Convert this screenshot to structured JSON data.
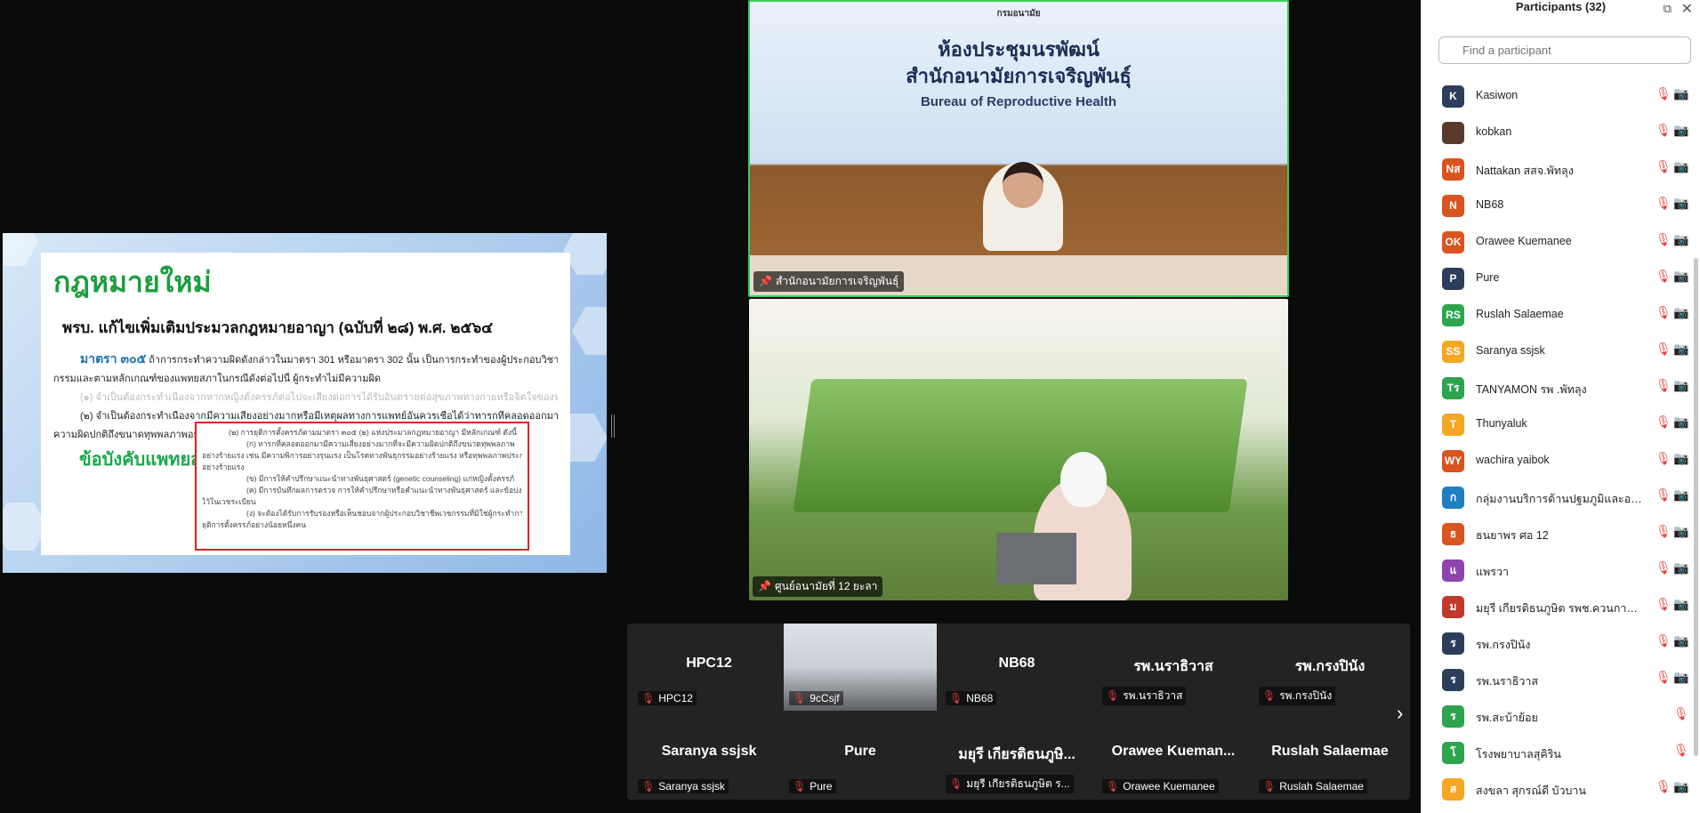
{
  "shared_slide": {
    "title": "กฎหมายใหม่",
    "subtitle": "พรบ. แก้ไขเพิ่มเติมประมวลกฎหมายอาญา (ฉบับที่ ๒๘) พ.ศ. ๒๕๖๔",
    "section_label": "มาตรา ๓๐๕",
    "line1": "ถ้าการกระทำความผิดดังกล่าวในมาตรา 301 หรือมาตรา 302 นั้น เป็นการกระทำของผู้ประกอบวิชาชีพเวช",
    "line2": "กรรมและตามหลักเกณฑ์ของแพทยสภาในกรณีดังต่อไปนี้ ผู้กระทำไม่มีความผิด",
    "line3": "(๑) จำเป็นต้องกระทำเนื่องจากหากหญิงตั้งครรภ์ต่อไปจะเสี่ยงต่อการได้รับอันตรายต่อสุขภาพทางกายหรือจิตใจของหญิงนั้น",
    "line4": "(๒) จำเป็นต้องกระทำเนื่องจากมีความเสี่ยงอย่างมากหรือมีเหตุผลทางการแพทย์อันควรเชื่อได้ว่าทารกที่คลอดออกมาจะมี",
    "line5": "ความผิดปกติถึงขนาดทุพพลภาพอย่างร้ายแรง",
    "watermark": "ข้อบังคับแพทยสภา",
    "box_lines": [
      "(๒) การยุติการตั้งครรภ์ตามมาตรา ๓๐๕ (๒) แห่งประมวลกฎหมายอาญา มีหลักเกณฑ์ ดังนี้",
      "(ก) ทารกที่คลอดออกมามีความเสี่ยงอย่างมากที่จะมีความผิดปกติถึงขนาดทุพพลภาพ",
      "อย่างร้ายแรง เช่น มีความพิการอย่างรุนแรง เป็นโรคทางพันธุกรรมอย่างร้ายแรง หรือทุพพลภาพประการอื่น",
      "อย่างร้ายแรง",
      "(ข) มีการให้คำปรึกษาแนะนำทางพันธุศาสตร์ (genetic counseling) แก่หญิงตั้งครรภ์",
      "(ค) มีการบันทึกผลการตรวจ การให้คำปรึกษาหรือคำแนะนำทางพันธุศาสตร์ และข้อบ่งชี้",
      "ไว้ในเวชระเบียน",
      "(ง) จะต้องได้รับการรับรองหรือเห็นชอบจากผู้ประกอบวิชาชีพเวชกรรมที่มิใช่ผู้กระทำการ",
      "ยุติการตั้งครรภ์อย่างน้อยหนึ่งคน"
    ]
  },
  "video_top": {
    "logo_text": "กรมอนามัย",
    "room_line1": "ห้องประชุมนรพัฒน์",
    "room_line2": "สำนักอนามัยการเจริญพันธุ์",
    "room_en": "Bureau of Reproductive Health",
    "name": "สำนักอนามัยการเจริญพันธุ์"
  },
  "video_bottom": {
    "name": "ศูนย์อนามัยที่ 12 ยะลา"
  },
  "gallery": {
    "tiles": [
      {
        "name": "HPC12",
        "label": "HPC12"
      },
      {
        "name": "",
        "label": "9cCsjf"
      },
      {
        "name": "NB68",
        "label": "NB68"
      },
      {
        "name": "รพ.นราธิวาส",
        "label": "รพ.นราธิวาส"
      },
      {
        "name": "รพ.กรงปินัง",
        "label": "รพ.กรงปินัง"
      },
      {
        "name": "Saranya ssjsk",
        "label": "Saranya ssjsk"
      },
      {
        "name": "Pure",
        "label": "Pure"
      },
      {
        "name": "มยุรี เกียรติธนภูษิ...",
        "label": "มยุรี เกียรติธนภูษิต ร..."
      },
      {
        "name": "Orawee  Kueman...",
        "label": "Orawee Kuemanee"
      },
      {
        "name": "Ruslah Salaemae",
        "label": "Ruslah Salaemae"
      }
    ]
  },
  "participants": {
    "title": "Participants (32)",
    "search_placeholder": "Find a participant",
    "list": [
      {
        "initials": "K",
        "name": "Kasiwon",
        "color": "#2d3e5c",
        "cam_muted": true
      },
      {
        "initials": "",
        "name": "kobkan",
        "color": "#5a3a2a",
        "cam_muted": true
      },
      {
        "initials": "Nส",
        "name": "Nattakan สสจ.พัทลุง",
        "color": "#d9541e",
        "cam_muted": true
      },
      {
        "initials": "N",
        "name": "NB68",
        "color": "#d9541e",
        "cam_muted": true
      },
      {
        "initials": "OK",
        "name": "Orawee Kuemanee",
        "color": "#d9541e",
        "cam_muted": true
      },
      {
        "initials": "P",
        "name": "Pure",
        "color": "#2d3e5c",
        "cam_muted": true
      },
      {
        "initials": "RS",
        "name": "Ruslah Salaemae",
        "color": "#2ea44f",
        "cam_muted": true
      },
      {
        "initials": "SS",
        "name": "Saranya ssjsk",
        "color": "#f5a623",
        "cam_muted": true
      },
      {
        "initials": "Tร",
        "name": "TANYAMON รพ .พัทลุง",
        "color": "#2ea44f",
        "cam_muted": true
      },
      {
        "initials": "T",
        "name": "Thunyaluk",
        "color": "#f5a623",
        "cam_muted": true
      },
      {
        "initials": "WY",
        "name": "wachira yaibok",
        "color": "#d9541e",
        "cam_muted": true
      },
      {
        "initials": "ก",
        "name": "กลุ่มงานบริการด้านปฐมภูมิและองค์รวม รพ....",
        "color": "#1e7fc1",
        "cam_muted": true
      },
      {
        "initials": "ธ",
        "name": "ธนยาพร ศอ 12",
        "color": "#d9541e",
        "cam_muted": true
      },
      {
        "initials": "แ",
        "name": "แพรวา",
        "color": "#8e44ad",
        "cam_muted": true
      },
      {
        "initials": "ม",
        "name": "มยุรี เกียรติธนภูษิต รพช.ควนกาหลง ...",
        "color": "#c0392b",
        "cam_muted": true
      },
      {
        "initials": "ร",
        "name": "รพ.กรงปินัง",
        "color": "#2d3e5c",
        "cam_muted": true
      },
      {
        "initials": "ร",
        "name": "รพ.นราธิวาส",
        "color": "#2d3e5c",
        "cam_muted": true
      },
      {
        "initials": "ร",
        "name": "รพ.สะบ้าย้อย",
        "color": "#2ea44f",
        "cam_muted": false
      },
      {
        "initials": "โ",
        "name": "โรงพยาบาลสุคิริน",
        "color": "#2ea44f",
        "cam_muted": false
      },
      {
        "initials": "ส",
        "name": "สงขลา สุกรณ์ดี บัวบาน",
        "color": "#f5a623",
        "cam_muted": true
      }
    ]
  }
}
